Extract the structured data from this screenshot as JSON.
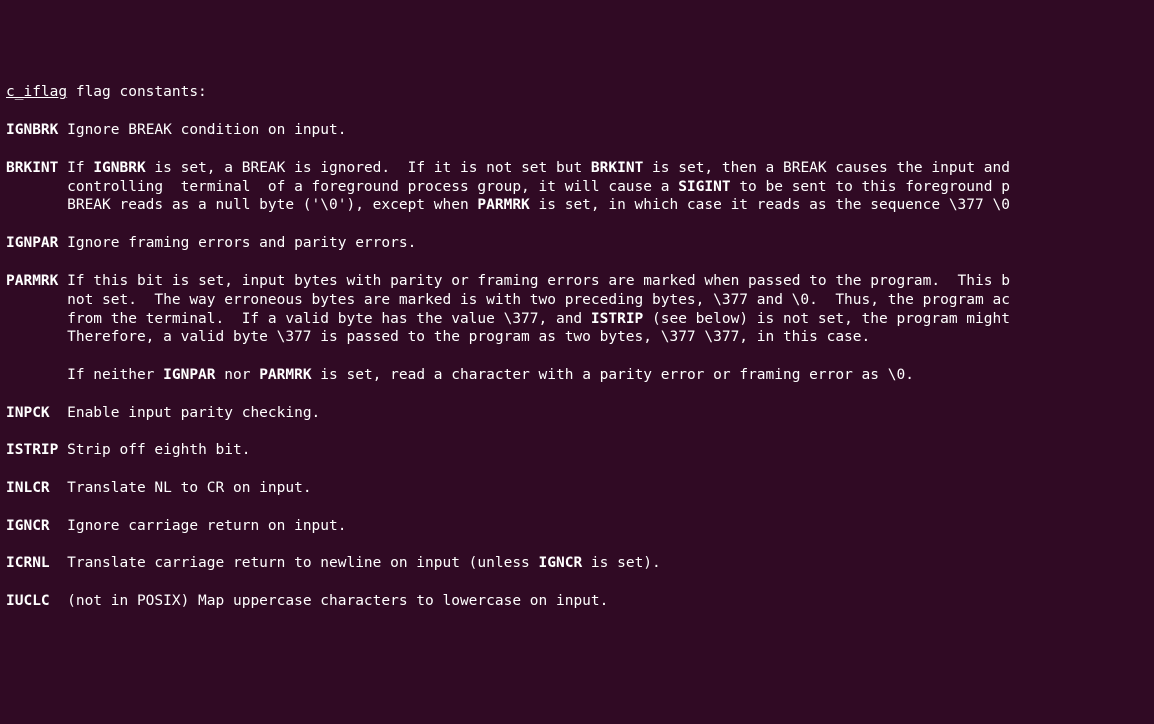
{
  "header": {
    "underlined": "c_iflag",
    "rest": " flag constants:"
  },
  "entries": [
    {
      "term": "IGNBRK",
      "text": " Ignore BREAK condition on input."
    },
    {
      "term": "BRKINT",
      "lines": [
        {
          "prefix": " If ",
          "parts": [
            {
              "b": "IGNBRK"
            },
            {
              "t": " is set, a BREAK is ignored.  If it is not set but "
            },
            {
              "b": "BRKINT"
            },
            {
              "t": " is set, then a BREAK causes the input and"
            }
          ]
        },
        {
          "prefix": "       controlling  terminal  of a foreground process group, it will cause a ",
          "parts": [
            {
              "b": "SIGINT"
            },
            {
              "t": " to be sent to this foreground p"
            }
          ]
        },
        {
          "prefix": "       BREAK reads as a null byte ('\\0'), except when ",
          "parts": [
            {
              "b": "PARMRK"
            },
            {
              "t": " is set, in which case it reads as the sequence \\377 \\0"
            }
          ]
        }
      ]
    },
    {
      "term": "IGNPAR",
      "text": " Ignore framing errors and parity errors."
    },
    {
      "term": "PARMRK",
      "lines": [
        {
          "prefix": " If this bit is set, input bytes with parity or framing errors are marked when passed to the program.  This b",
          "parts": []
        },
        {
          "prefix": "       not set.  The way erroneous bytes are marked is with two preceding bytes, \\377 and \\0.  Thus, the program ac",
          "parts": []
        },
        {
          "prefix": "       from the terminal.  If a valid byte has the value \\377, and ",
          "parts": [
            {
              "b": "ISTRIP"
            },
            {
              "t": " (see below) is not set, the program might"
            }
          ]
        },
        {
          "prefix": "       Therefore, a valid byte \\377 is passed to the program as two bytes, \\377 \\377, in this case.",
          "parts": []
        }
      ],
      "extra": [
        {
          "prefix": "       If neither ",
          "parts": [
            {
              "b": "IGNPAR"
            },
            {
              "t": " nor "
            },
            {
              "b": "PARMRK"
            },
            {
              "t": " is set, read a character with a parity error or framing error as \\0."
            }
          ]
        }
      ]
    },
    {
      "term": "INPCK",
      "text": "  Enable input parity checking."
    },
    {
      "term": "ISTRIP",
      "text": " Strip off eighth bit."
    },
    {
      "term": "INLCR",
      "text": "  Translate NL to CR on input."
    },
    {
      "term": "IGNCR",
      "text": "  Ignore carriage return on input."
    },
    {
      "term": "ICRNL",
      "lines": [
        {
          "prefix": "  Translate carriage return to newline on input (unless ",
          "parts": [
            {
              "b": "IGNCR"
            },
            {
              "t": " is set)."
            }
          ]
        }
      ]
    },
    {
      "term": "IUCLC",
      "text": "  (not in POSIX) Map uppercase characters to lowercase on input."
    }
  ]
}
